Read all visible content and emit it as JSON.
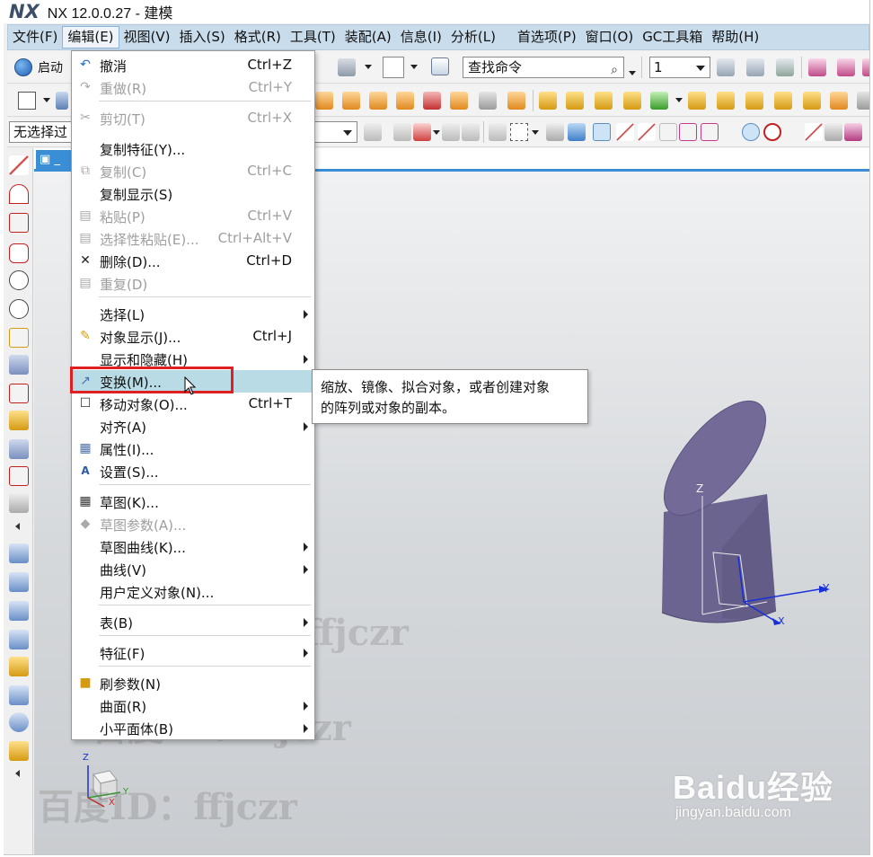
{
  "window": {
    "logo": "NX",
    "title": "NX 12.0.0.27 - 建模"
  },
  "menubar": {
    "items": [
      "文件(F)",
      "编辑(E)",
      "视图(V)",
      "插入(S)",
      "格式(R)",
      "工具(T)",
      "装配(A)",
      "信息(I)",
      "分析(L)",
      "首选项(P)",
      "窗口(O)",
      "GC工具箱",
      "帮助(H)"
    ],
    "active": "编辑(E)"
  },
  "toolbar": {
    "start_label": "启动",
    "search_placeholder": "查找命令",
    "layer_value": "1",
    "filter_value": "无选择过"
  },
  "graphics": {
    "tab_label": "_"
  },
  "edit_menu": {
    "items": [
      {
        "label": "撤消",
        "shortcut": "Ctrl+Z",
        "enabled": true,
        "icon": "undo-icon"
      },
      {
        "label": "重做(R)",
        "shortcut": "Ctrl+Y",
        "enabled": false,
        "icon": "redo-icon"
      },
      {
        "label": "剪切(T)",
        "shortcut": "Ctrl+X",
        "enabled": false,
        "icon": "cut-icon"
      },
      {
        "label": "复制特征(Y)...",
        "shortcut": "",
        "enabled": true,
        "icon": ""
      },
      {
        "label": "复制(C)",
        "shortcut": "Ctrl+C",
        "enabled": false,
        "icon": "copy-icon"
      },
      {
        "label": "复制显示(S)",
        "shortcut": "",
        "enabled": true,
        "icon": ""
      },
      {
        "label": "粘贴(P)",
        "shortcut": "Ctrl+V",
        "enabled": false,
        "icon": "paste-icon"
      },
      {
        "label": "选择性粘贴(E)...",
        "shortcut": "Ctrl+Alt+V",
        "enabled": false,
        "icon": "paste-special-icon"
      },
      {
        "label": "删除(D)...",
        "shortcut": "Ctrl+D",
        "enabled": true,
        "icon": "delete-icon"
      },
      {
        "label": "重复(D)",
        "shortcut": "",
        "enabled": false,
        "icon": "repeat-icon"
      },
      {
        "label": "选择(L)",
        "shortcut": "",
        "enabled": true,
        "icon": "",
        "submenu": true
      },
      {
        "label": "对象显示(J)...",
        "shortcut": "Ctrl+J",
        "enabled": true,
        "icon": "object-display-icon"
      },
      {
        "label": "显示和隐藏(H)",
        "shortcut": "",
        "enabled": true,
        "icon": "",
        "submenu": true
      },
      {
        "label": "变换(M)...",
        "shortcut": "",
        "enabled": true,
        "icon": "transform-icon",
        "highlighted": true
      },
      {
        "label": "移动对象(O)...",
        "shortcut": "Ctrl+T",
        "enabled": true,
        "icon": "move-object-icon"
      },
      {
        "label": "对齐(A)",
        "shortcut": "",
        "enabled": true,
        "icon": "",
        "submenu": true
      },
      {
        "label": "属性(I)...",
        "shortcut": "",
        "enabled": true,
        "icon": "properties-icon"
      },
      {
        "label": "设置(S)...",
        "shortcut": "",
        "enabled": true,
        "icon": "settings-icon"
      },
      {
        "label": "草图(K)...",
        "shortcut": "",
        "enabled": true,
        "icon": "sketch-icon"
      },
      {
        "label": "草图参数(A)...",
        "shortcut": "",
        "enabled": false,
        "icon": "sketch-params-icon"
      },
      {
        "label": "草图曲线(K)...",
        "shortcut": "",
        "enabled": true,
        "icon": "",
        "submenu": true
      },
      {
        "label": "曲线(V)",
        "shortcut": "",
        "enabled": true,
        "icon": "",
        "submenu": true
      },
      {
        "label": "用户定义对象(N)...",
        "shortcut": "",
        "enabled": true,
        "icon": ""
      },
      {
        "label": "表(B)",
        "shortcut": "",
        "enabled": true,
        "icon": "",
        "submenu": true
      },
      {
        "label": "特征(F)",
        "shortcut": "",
        "enabled": true,
        "icon": "",
        "submenu": true
      },
      {
        "label": "刷参数(N)",
        "shortcut": "",
        "enabled": true,
        "icon": "brush-params-icon"
      },
      {
        "label": "曲面(R)",
        "shortcut": "",
        "enabled": true,
        "icon": "",
        "submenu": true
      },
      {
        "label": "小平面体(B)",
        "shortcut": "",
        "enabled": true,
        "icon": "",
        "submenu": true
      }
    ]
  },
  "tooltip": {
    "line1": "缩放、镜像、拟合对象，或者创建对象",
    "line2": "的阵列或对象的副本。"
  },
  "axes": {
    "z": "Z",
    "y": "Y",
    "x": "X"
  },
  "watermarks": [
    "百度ID：ffjczr",
    "百度ID：ffjczr",
    "百度ID：ffjczr"
  ],
  "brand": {
    "logo": "Baidu经验",
    "site": "jingyan.baidu.com"
  },
  "colors": {
    "menubar_bg": "#c9dcec",
    "highlight": "#b8dbe6",
    "red_box": "#e02020",
    "solid": "#6c6490"
  }
}
